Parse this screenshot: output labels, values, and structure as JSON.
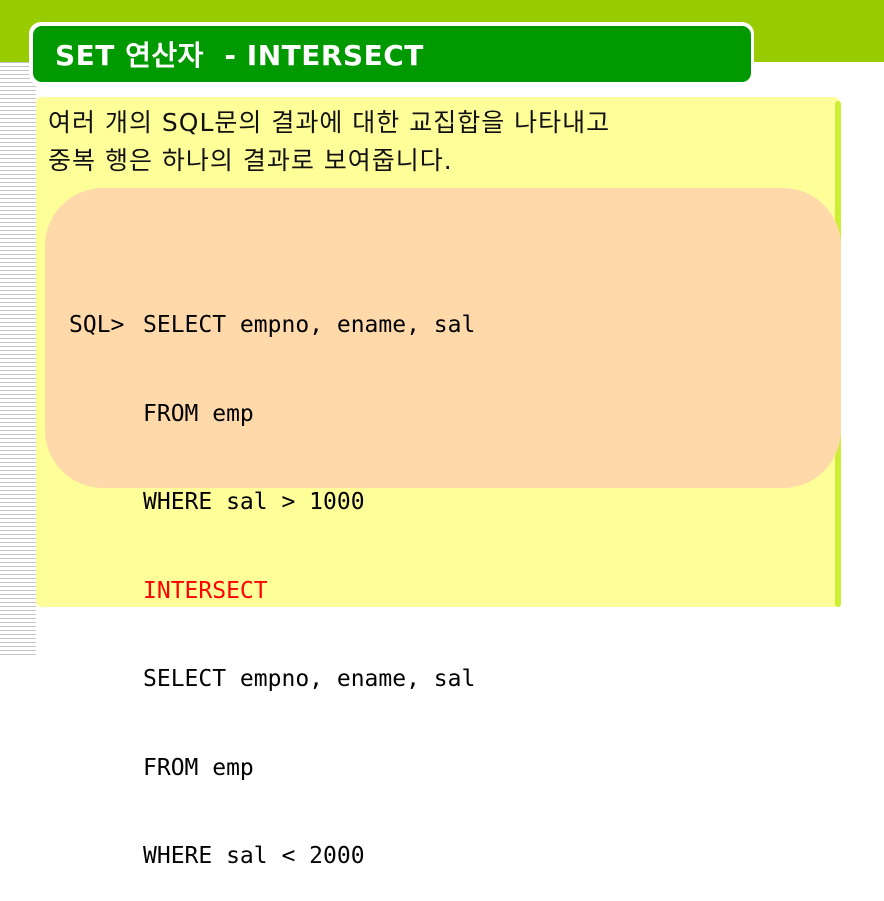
{
  "slide": {
    "title": "SET 연산자  - INTERSECT",
    "intro_lines": [
      "여러 개의 SQL문의 결과에 대한 교집합을 나타내고",
      "중복 행은 하나의 결과로 보여줍니다."
    ],
    "code": {
      "prompt": "SQL>",
      "lines": [
        "SELECT empno, ename, sal",
        "FROM emp",
        "WHERE sal > 1000",
        "INTERSECT",
        "SELECT empno, ename, sal",
        "FROM emp",
        "WHERE sal < 2000"
      ],
      "highlight_line_index": 3,
      "highlight_color": "#ff0000"
    }
  },
  "colors": {
    "top_band": "#99cc00",
    "title_background": "#009900",
    "title_text": "#ffffff",
    "panel_background": "#ffff99",
    "code_background": "#ffd9aa"
  }
}
